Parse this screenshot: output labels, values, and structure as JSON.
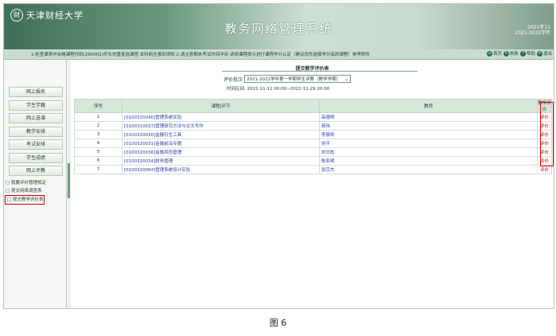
{
  "header": {
    "logo_text": "天津财经大学",
    "logo_mark": "财",
    "system_title": "教务网络管理系统",
    "date_line1": "2021年11",
    "date_line2": "2021-2022学年"
  },
  "notice": {
    "text": "1.检查课表中合格课程代码(260002)开头勿重复选课程    本科新生报到须知    2.请注意期末考试时间冲突    请按课程提示进行课程学分认定（建议优先选择学分高的课程）参考附件"
  },
  "toplinks": [
    {
      "icon": "home-icon",
      "label": "首页"
    },
    {
      "icon": "refresh-icon",
      "label": "刷新"
    },
    {
      "icon": "help-icon",
      "label": "帮助"
    },
    {
      "icon": "exit-icon",
      "label": "退出"
    }
  ],
  "sidebar": {
    "menu": [
      {
        "label": "网上报名"
      },
      {
        "label": "学生学籍"
      },
      {
        "label": "网上选课"
      },
      {
        "label": "教学安排"
      },
      {
        "label": "考试安排"
      },
      {
        "label": "学生成绩"
      },
      {
        "label": "网上评教"
      }
    ],
    "sublinks": [
      {
        "label": "□ 我要评价管理规定",
        "active": false
      },
      {
        "label": "□ 提交网络调查表",
        "active": false
      },
      {
        "label": "□ 提交教学评价表",
        "active": true
      }
    ]
  },
  "main": {
    "page_title": "提交教学评价表",
    "filter_label": "评价批次",
    "filter_value": "2021-2022学年第一学期学生评教（教学学期）",
    "time_label": "时间区间:",
    "time_value": "2021-11-11 00:00~2021-11-29 20:00",
    "columns": [
      "序号",
      "课程|环节",
      "教师",
      "教学评价"
    ],
    "rows": [
      {
        "no": "1",
        "course": "[0100320040]管理系统实验",
        "teacher": "高德明",
        "action": "评价"
      },
      {
        "no": "2",
        "course": "[0100310037]管理研究方法与论文写作",
        "teacher": "郝伟",
        "action": "评价"
      },
      {
        "no": "3",
        "course": "[0100320030]金融衍生工具",
        "teacher": "李振凯",
        "action": "评价"
      },
      {
        "no": "4",
        "course": "[0100320031]金融前沿专题",
        "teacher": "刘平",
        "action": "评价"
      },
      {
        "no": "5",
        "course": "[0100320036]金融风险管理",
        "teacher": "刘文彪",
        "action": "评价"
      },
      {
        "no": "6",
        "course": "[0100320034]财务管理",
        "teacher": "陈亚明",
        "action": "评价"
      },
      {
        "no": "7",
        "course": "[0100320064]管理系统设计实验",
        "teacher": "张宗杰",
        "action": "评价"
      }
    ]
  },
  "caption": "图 6",
  "colors": {
    "header_green": "#3f6f56",
    "highlight_red": "#e00000",
    "link_blue": "#2840a0"
  }
}
